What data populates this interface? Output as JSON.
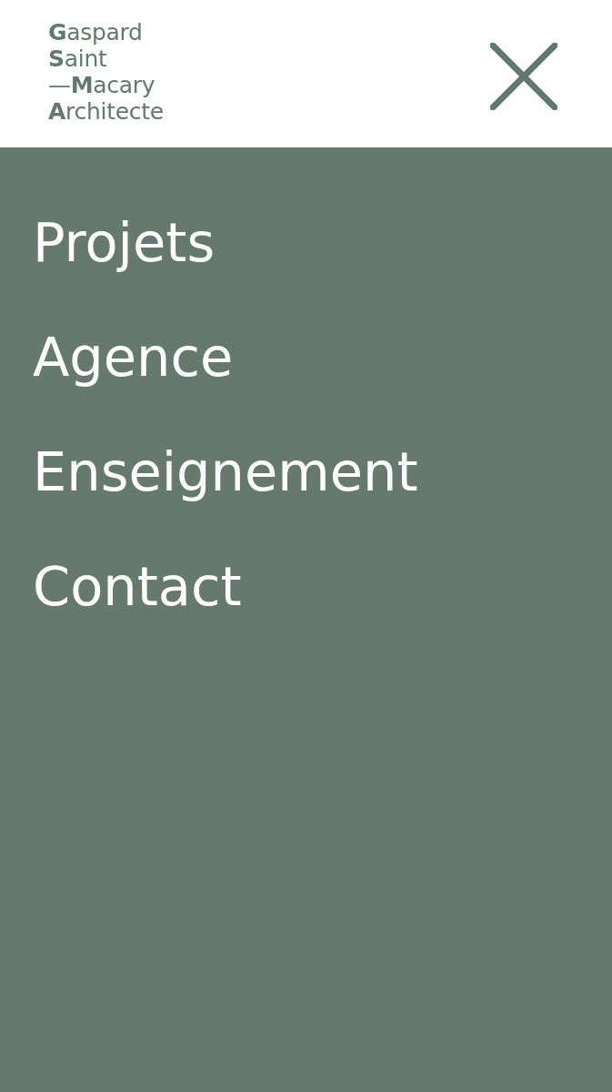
{
  "header": {
    "logo": [
      "**G**aspard",
      "**S**aint",
      "—**M**acary",
      "**A**rchitecte"
    ]
  },
  "menu": {
    "open": true,
    "items": [
      "Projets",
      "Agence",
      "Enseignement",
      "Contact"
    ]
  }
}
